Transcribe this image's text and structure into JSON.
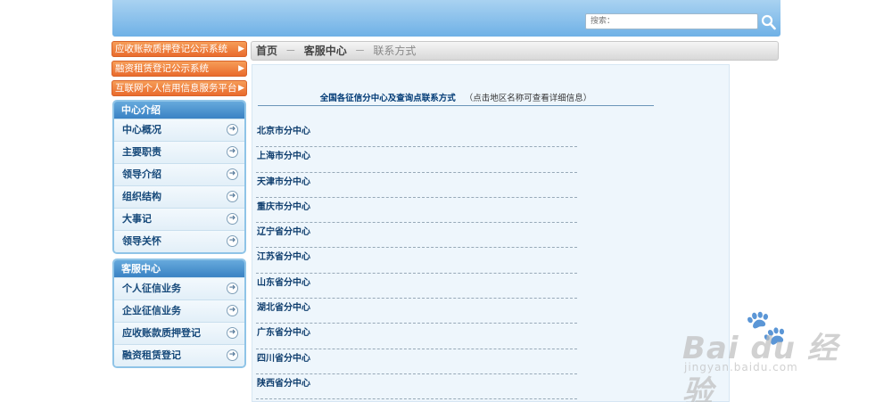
{
  "header": {
    "search_placeholder": "搜索："
  },
  "quick_links": [
    {
      "label": "应收账款质押登记公示系统"
    },
    {
      "label": "融资租赁登记公示系统"
    },
    {
      "label": "互联网个人信用信息服务平台"
    }
  ],
  "center_intro": {
    "title": "中心介绍",
    "items": [
      {
        "label": "中心概况"
      },
      {
        "label": "主要职责"
      },
      {
        "label": "领导介绍"
      },
      {
        "label": "组织结构"
      },
      {
        "label": "大事记"
      },
      {
        "label": "领导关怀"
      }
    ]
  },
  "service_center": {
    "title": "客服中心",
    "items": [
      {
        "label": "个人征信业务"
      },
      {
        "label": "企业征信业务"
      },
      {
        "label": "应收账款质押登记"
      },
      {
        "label": "融资租赁登记"
      }
    ]
  },
  "breadcrumb": {
    "home": "首页",
    "section": "客服中心",
    "current": "联系方式",
    "separator": "－"
  },
  "main": {
    "title": "全国各征信分中心及查询点联系方式",
    "note": "（点击地区名称可查看详细信息）",
    "centers": [
      "北京市分中心",
      "上海市分中心",
      "天津市分中心",
      "重庆市分中心",
      "辽宁省分中心",
      "江苏省分中心",
      "山东省分中心",
      "湖北省分中心",
      "广东省分中心",
      "四川省分中心",
      "陕西省分中心"
    ]
  },
  "watermark": {
    "brand": "Bai du 经验",
    "url": "jingyan.baidu.com"
  },
  "icons": {
    "search": "magnifier-icon",
    "arrow": "right-triangle-icon",
    "circle_arrow": "circle-arrow-icon"
  },
  "colors": {
    "header": "#6fb1e6",
    "orange_button": "#e8682a",
    "panel_header": "#3a82c4",
    "link_text": "#0f3e6e"
  }
}
